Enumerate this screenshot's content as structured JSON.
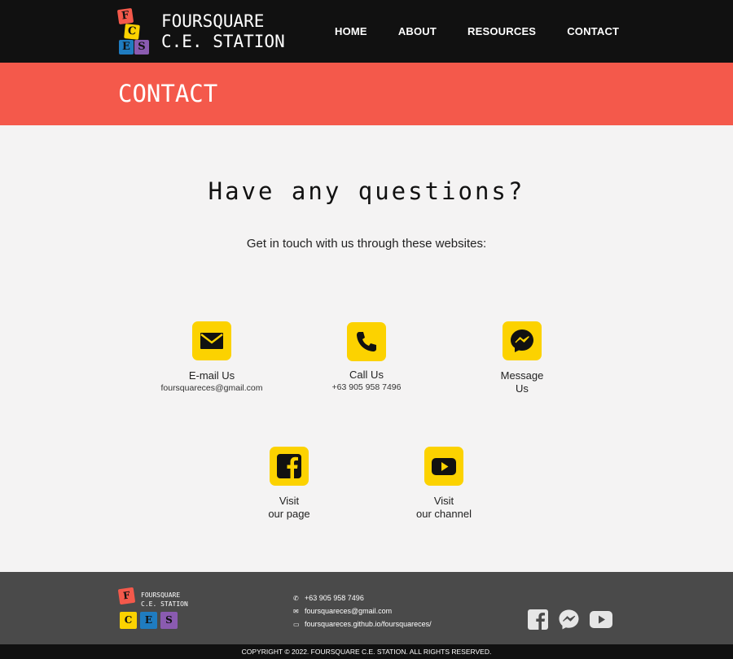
{
  "header": {
    "logo_title": "FOURSQUARE C.E. STATION",
    "logo_line1": "FOURSQUARE",
    "logo_line2": "C.E. STATION",
    "tiles": [
      "F",
      "C",
      "E",
      "S"
    ],
    "nav": [
      "HOME",
      "ABOUT",
      "RESOURCES",
      "CONTACT"
    ]
  },
  "banner": {
    "title": "CONTACT"
  },
  "main": {
    "heading": "Have any questions?",
    "subheading": "Get in touch with us through these websites:",
    "cards": [
      {
        "label": "E-mail Us",
        "detail": "foursquareces@gmail.com",
        "icon": "envelope-icon"
      },
      {
        "label": "Call Us",
        "detail": "+63 905 958 7496",
        "icon": "phone-icon"
      },
      {
        "label_line1": "Message",
        "label_line2": "Us",
        "icon": "messenger-icon"
      },
      {
        "label_line1": "Visit",
        "label_line2": "our page",
        "icon": "facebook-icon"
      },
      {
        "label_line1": "Visit",
        "label_line2": "our channel",
        "icon": "youtube-icon"
      }
    ]
  },
  "footer": {
    "logo_line1": "FOURSQUARE",
    "logo_line2": "C.E. STATION",
    "phone": "+63 905 958 7496",
    "email": "foursquareces@gmail.com",
    "website": "foursquareces.github.io/foursquareces/",
    "social": [
      "facebook-icon",
      "messenger-icon",
      "youtube-icon"
    ],
    "copyright": "COPYRIGHT © 2022. FOURSQUARE C.E. STATION. ALL RIGHTS RESERVED."
  },
  "colors": {
    "header_bg": "#111111",
    "banner_bg": "#f4594b",
    "icon_bg": "#fcd200",
    "footer_bg": "#4a4a4a",
    "tile_f": "#f4594b",
    "tile_c": "#fcd200",
    "tile_e": "#1f7cc0",
    "tile_s": "#8a5bb0"
  }
}
